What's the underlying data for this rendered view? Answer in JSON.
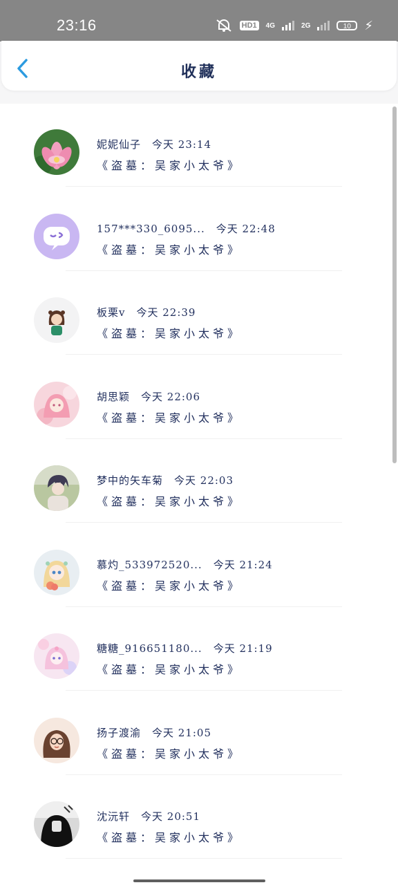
{
  "status_bar": {
    "time": "23:16",
    "hd_label": "HD1",
    "net1": "4G",
    "net2": "2G",
    "battery": "10"
  },
  "header": {
    "title": "收藏",
    "back_icon": "chevron-left-icon",
    "accent": "#2c9be0"
  },
  "items": [
    {
      "name": "妮妮仙子",
      "time": "今天 23:14",
      "work": "《盗墓：吴家小太爷》",
      "avatar_icon": "lotus-avatar"
    },
    {
      "name": "157***330_6095...",
      "time": "今天 22:48",
      "work": "《盗墓：吴家小太爷》",
      "avatar_icon": "chat-bubble-avatar"
    },
    {
      "name": "板栗v",
      "time": "今天 22:39",
      "work": "《盗墓：吴家小太爷》",
      "avatar_icon": "cartoon-girl-avatar"
    },
    {
      "name": "胡思颖",
      "time": "今天 22:06",
      "work": "《盗墓：吴家小太爷》",
      "avatar_icon": "pink-hair-girl-avatar"
    },
    {
      "name": "梦中的矢车菊",
      "time": "今天 22:03",
      "work": "《盗墓：吴家小太爷》",
      "avatar_icon": "anime-boy-avatar"
    },
    {
      "name": "慕灼_533972520...",
      "time": "今天 21:24",
      "work": "《盗墓：吴家小太爷》",
      "avatar_icon": "blonde-girl-avatar"
    },
    {
      "name": "糖糖_916651180...",
      "time": "今天 21:19",
      "work": "《盗墓：吴家小太爷》",
      "avatar_icon": "pastel-girl-avatar"
    },
    {
      "name": "扬子渡渝",
      "time": "今天 21:05",
      "work": "《盗墓：吴家小太爷》",
      "avatar_icon": "glasses-girl-avatar"
    },
    {
      "name": "沈沅轩",
      "time": "今天 20:51",
      "work": "《盗墓：吴家小太爷》",
      "avatar_icon": "hooded-figure-avatar"
    }
  ]
}
